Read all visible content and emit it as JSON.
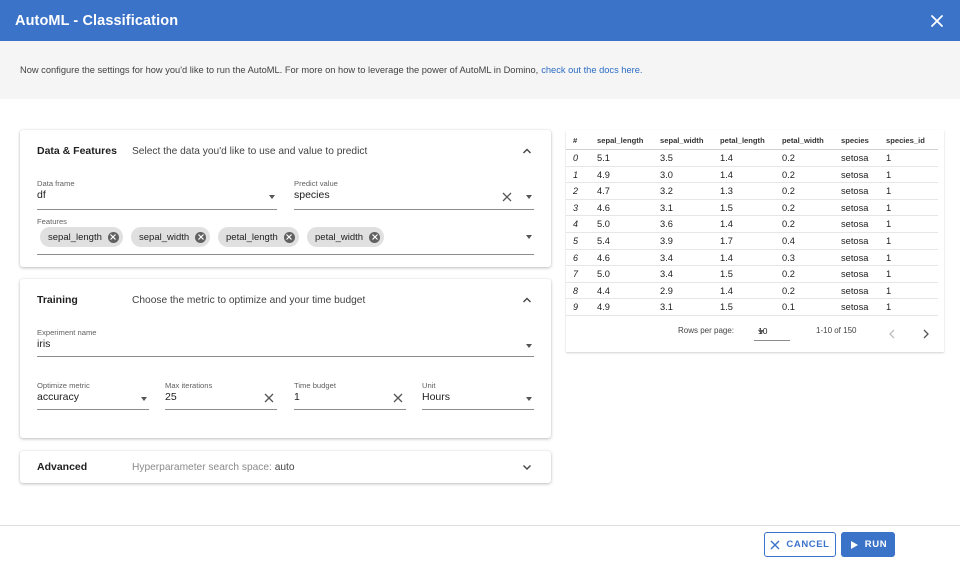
{
  "dialog": {
    "title": "AutoML - Classification"
  },
  "intro": {
    "text": "Now configure the settings for how you'd like to run the AutoML. For more on how to leverage the power of AutoML in Domino,",
    "link": "check out the docs here."
  },
  "data_features": {
    "title": "Data & Features",
    "subtitle": "Select the data you'd like to use and value to predict",
    "data_frame": {
      "label": "Data frame",
      "value": "df"
    },
    "predict_value": {
      "label": "Predict value",
      "value": "species"
    },
    "features": {
      "label": "Features",
      "chips": [
        "sepal_length",
        "sepal_width",
        "petal_length",
        "petal_width"
      ]
    }
  },
  "training": {
    "title": "Training",
    "subtitle": "Choose the metric to optimize and your time budget",
    "experiment_name": {
      "label": "Experiment name",
      "value": "iris"
    },
    "optimize_metric": {
      "label": "Optimize metric",
      "value": "accuracy"
    },
    "max_iterations": {
      "label": "Max iterations",
      "value": "25"
    },
    "time_budget": {
      "label": "Time budget",
      "value": "1"
    },
    "unit": {
      "label": "Unit",
      "value": "Hours"
    }
  },
  "advanced": {
    "title": "Advanced",
    "subtitle_label": "Hyperparameter search space:",
    "subtitle_value": "auto"
  },
  "table": {
    "columns": [
      "#",
      "sepal_length",
      "sepal_width",
      "petal_length",
      "petal_width",
      "species",
      "species_id"
    ],
    "rows": [
      [
        "0",
        "5.1",
        "3.5",
        "1.4",
        "0.2",
        "setosa",
        "1"
      ],
      [
        "1",
        "4.9",
        "3.0",
        "1.4",
        "0.2",
        "setosa",
        "1"
      ],
      [
        "2",
        "4.7",
        "3.2",
        "1.3",
        "0.2",
        "setosa",
        "1"
      ],
      [
        "3",
        "4.6",
        "3.1",
        "1.5",
        "0.2",
        "setosa",
        "1"
      ],
      [
        "4",
        "5.0",
        "3.6",
        "1.4",
        "0.2",
        "setosa",
        "1"
      ],
      [
        "5",
        "5.4",
        "3.9",
        "1.7",
        "0.4",
        "setosa",
        "1"
      ],
      [
        "6",
        "4.6",
        "3.4",
        "1.4",
        "0.3",
        "setosa",
        "1"
      ],
      [
        "7",
        "5.0",
        "3.4",
        "1.5",
        "0.2",
        "setosa",
        "1"
      ],
      [
        "8",
        "4.4",
        "2.9",
        "1.4",
        "0.2",
        "setosa",
        "1"
      ],
      [
        "9",
        "4.9",
        "3.1",
        "1.5",
        "0.1",
        "setosa",
        "1"
      ]
    ],
    "pagination": {
      "rows_per_page_label": "Rows per page:",
      "rows_per_page": "10",
      "range": "1-10 of 150"
    }
  },
  "footer": {
    "cancel_label": "CANCEL",
    "run_label": "RUN"
  },
  "colors": {
    "primary": "#3b73c9",
    "link": "#2c6cc4",
    "intro_bg": "#f5f5f5",
    "chip_bg": "#e0e0e0"
  }
}
